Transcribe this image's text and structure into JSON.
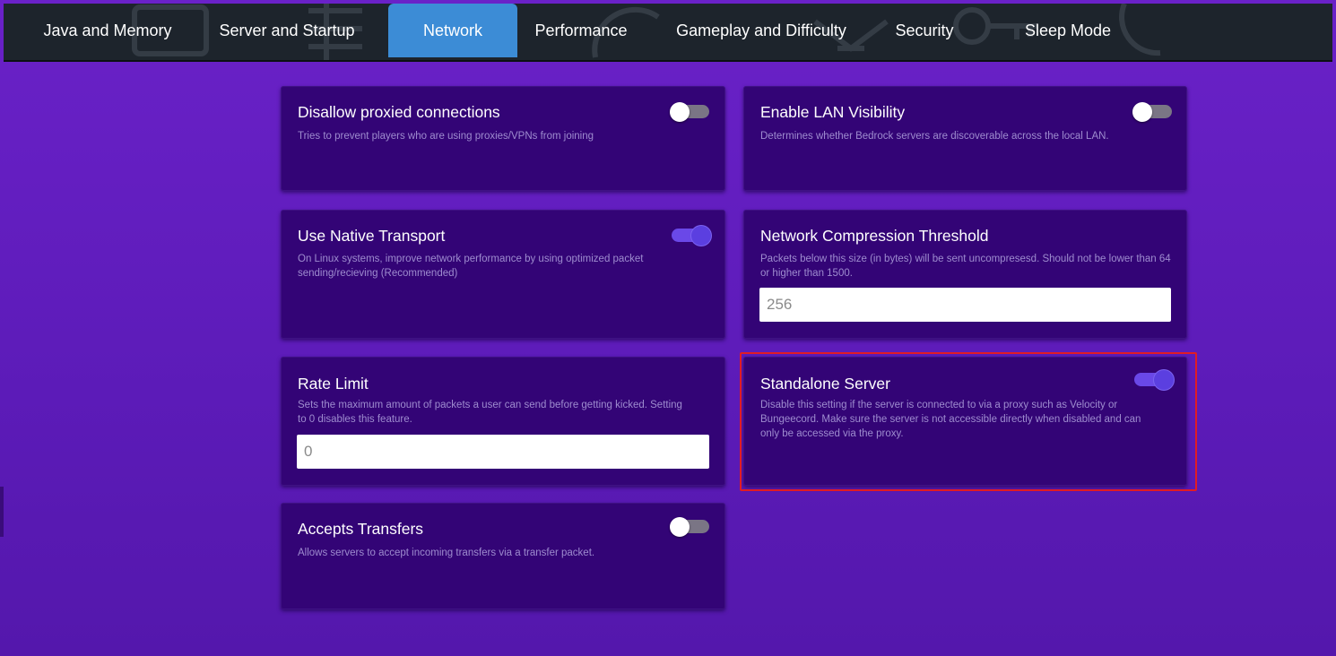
{
  "tabs": [
    {
      "label": "Java and Memory"
    },
    {
      "label": "Server and Startup"
    },
    {
      "label": "Network"
    },
    {
      "label": "Performance"
    },
    {
      "label": "Gameplay and Difficulty"
    },
    {
      "label": "Security"
    },
    {
      "label": "Sleep Mode"
    }
  ],
  "active_tab": "Network",
  "settings": {
    "disallow_proxied": {
      "title": "Disallow proxied connections",
      "description": "Tries to prevent players who are using proxies/VPNs from joining",
      "enabled": false
    },
    "lan_visibility": {
      "title": "Enable LAN Visibility",
      "description": "Determines whether Bedrock servers are discoverable across the local LAN.",
      "enabled": false
    },
    "native_transport": {
      "title": "Use Native Transport",
      "description": "On Linux systems, improve network performance by using optimized packet sending/recieving (Recommended)",
      "enabled": true
    },
    "compression_threshold": {
      "title": "Network Compression Threshold",
      "description": "Packets below this size (in bytes) will be sent uncompresesd. Should not be lower than 64 or higher than 1500.",
      "value": "256"
    },
    "rate_limit": {
      "title": "Rate Limit",
      "description": "Sets the maximum amount of packets a user can send before getting kicked. Setting to 0 disables this feature.",
      "value": "0"
    },
    "standalone_server": {
      "title": "Standalone Server",
      "description": "Disable this setting if the server is connected to via a proxy such as Velocity or Bungeecord. Make sure the server is not accessible directly when disabled and can only be accessed via the proxy.",
      "enabled": true
    },
    "accepts_transfers": {
      "title": "Accepts Transfers",
      "description": "Allows servers to accept incoming transfers via a transfer packet.",
      "enabled": false
    }
  },
  "colors": {
    "background": "#6a21c8",
    "card": "#330476",
    "active_tab": "#3c8cd6",
    "toggle_on": "#5b3fe0",
    "highlight": "#e11c24"
  }
}
